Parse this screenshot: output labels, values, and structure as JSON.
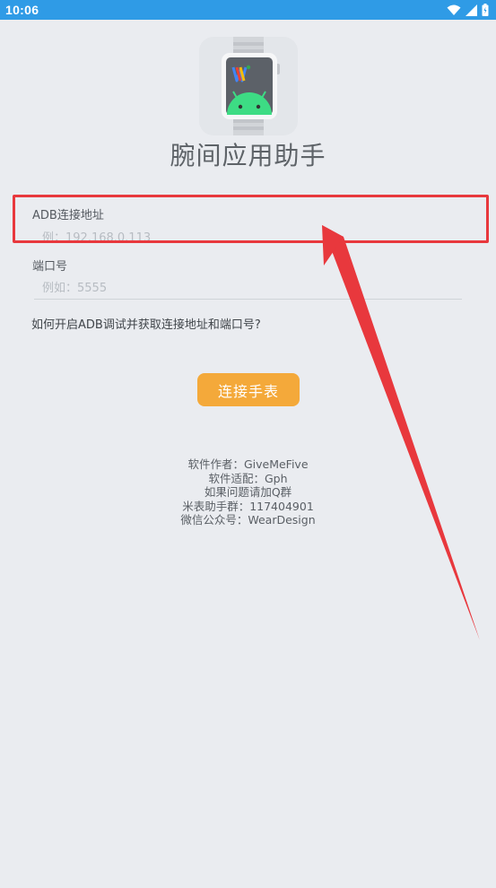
{
  "status_bar": {
    "time": "10:06",
    "icons": [
      "wifi-icon",
      "signal-icon",
      "battery-icon"
    ]
  },
  "app": {
    "title": "腕间应用助手",
    "logo_icon": "wear-os-android-watch-icon"
  },
  "form": {
    "adb_address": {
      "label": "ADB连接地址",
      "placeholder": "例：192.168.0.113",
      "value": ""
    },
    "port": {
      "label": "端口号",
      "placeholder": "例如：5555",
      "value": ""
    },
    "help_link": "如何开启ADB调试并获取连接地址和端口号?",
    "connect_button": "连接手表"
  },
  "credits": {
    "author": "软件作者：GiveMeFive",
    "adapted": "软件适配：Gph",
    "qq_prompt": "如果问题请加Q群",
    "qq_group": "米表助手群：117404901",
    "wechat": "微信公众号：WearDesign"
  },
  "annotation": {
    "highlight_color": "#e8383d",
    "arrow_color": "#e8383d"
  },
  "colors": {
    "status_bar": "#2f9be6",
    "background": "#eaecf0",
    "button": "#f4a93a"
  }
}
